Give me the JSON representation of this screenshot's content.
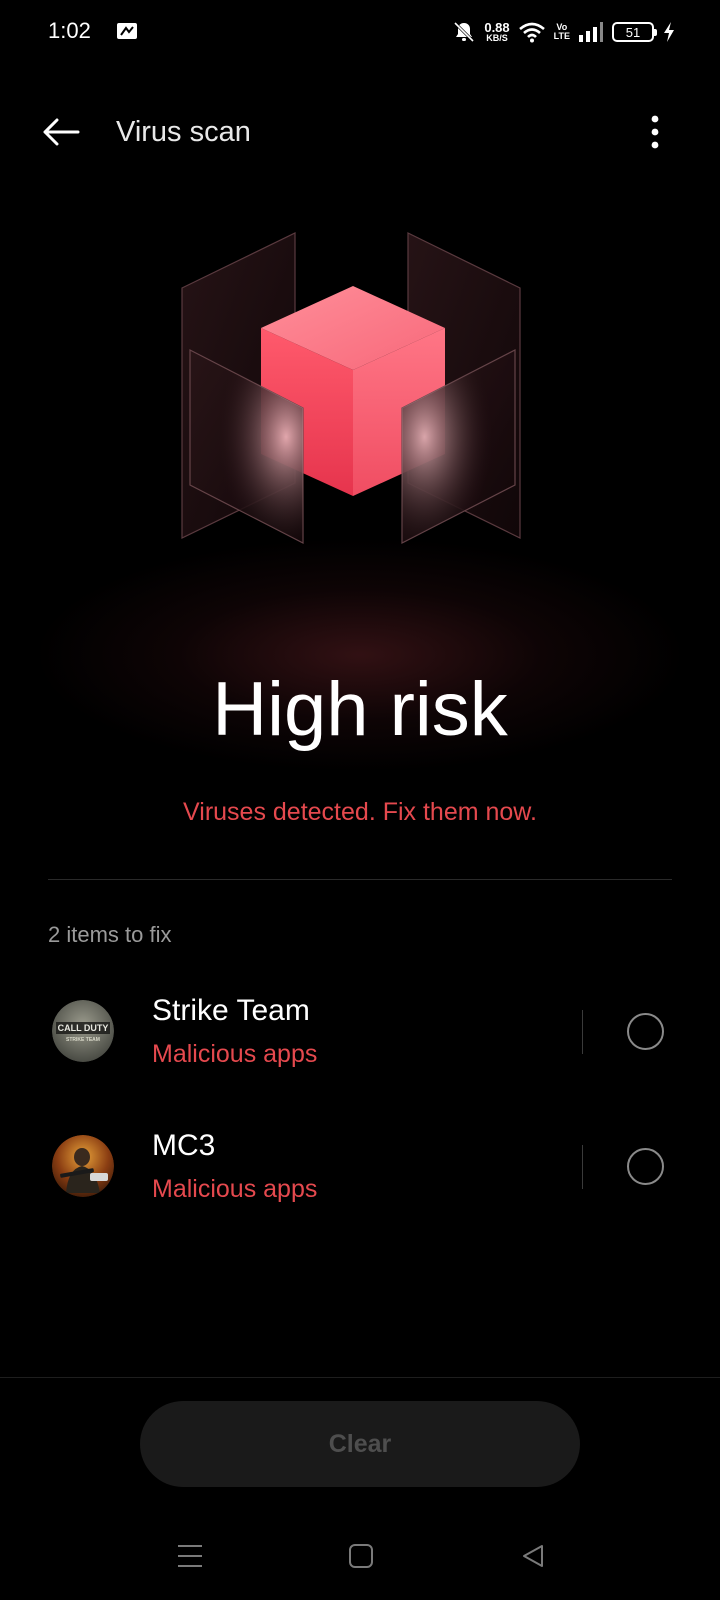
{
  "status_bar": {
    "time": "1:02",
    "net_speed_value": "0.88",
    "net_speed_unit": "KB/S",
    "volte_top": "Vo",
    "volte_bottom": "LTE",
    "battery": "51"
  },
  "header": {
    "title": "Virus scan"
  },
  "hero": {
    "risk_level": "High risk",
    "message": "Viruses detected. Fix them now."
  },
  "items_section": {
    "label": "2 items to fix",
    "items": [
      {
        "name": "Strike Team",
        "category": "Malicious apps",
        "icon_label": "CALL DUTY",
        "icon_sub": "STRIKE TEAM"
      },
      {
        "name": "MC3",
        "category": "Malicious apps"
      }
    ]
  },
  "actions": {
    "clear_label": "Clear"
  },
  "colors": {
    "background": "#000000",
    "warning_red": "#e5494e",
    "cube_pink": "#f2596a",
    "button_bg": "#1a1a1a",
    "button_text_disabled": "#4e4e4e"
  }
}
